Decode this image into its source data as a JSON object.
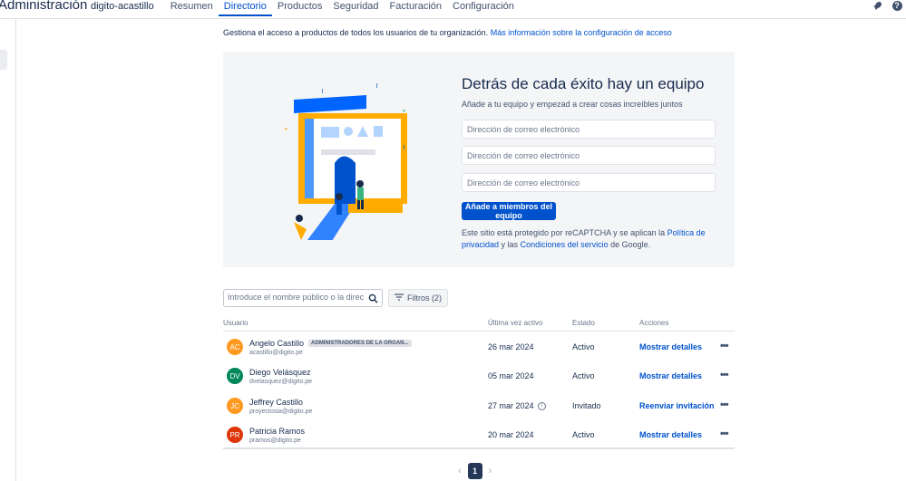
{
  "header": {
    "app_title": "Administración",
    "org_name": "digito-acastillo",
    "nav": [
      "Resumen",
      "Directorio",
      "Productos",
      "Seguridad",
      "Facturación",
      "Configuración"
    ],
    "active_nav": "Directorio"
  },
  "description": {
    "text": "Gestiona el acceso a productos de todos los usuarios de tu organización.",
    "link": "Más información sobre la configuración de acceso"
  },
  "invite": {
    "title": "Detrás de cada éxito hay un equipo",
    "subtitle": "Añade a tu equipo y empezad a crear cosas increíbles juntos",
    "email_placeholder": "Dirección de correo electrónico",
    "button": "Añade a miembros del equipo",
    "recaptcha_prefix": "Este sitio está protegido por reCAPTCHA y se aplican la",
    "privacy_link": "Política de privacidad",
    "recaptcha_middle": "y las",
    "terms_link": "Condiciones del servicio",
    "recaptcha_suffix": "de Google."
  },
  "search": {
    "placeholder": "Introduce el nombre público o la direcci"
  },
  "filters": {
    "label": "Filtros (2)"
  },
  "table": {
    "columns": [
      "Usuario",
      "Última vez activo",
      "Estado",
      "Acciones"
    ],
    "rows": [
      {
        "initials": "AC",
        "avatar_color": "#ff991f",
        "name": "Angelo Castillo",
        "badge": "ADMINISTRADORES DE LA ORGAN...",
        "email": "acastillo@digito.pe",
        "last_active": "26 mar 2024",
        "last_active_info": false,
        "status": "Activo",
        "action": "Mostrar detalles"
      },
      {
        "initials": "DV",
        "avatar_color": "#00875a",
        "name": "Diego Velásquez",
        "badge": "",
        "email": "dvelasquez@digito.pe",
        "last_active": "05 mar 2024",
        "last_active_info": false,
        "status": "Activo",
        "action": "Mostrar detalles"
      },
      {
        "initials": "JC",
        "avatar_color": "#ff991f",
        "name": "Jeffrey Castillo",
        "badge": "",
        "email": "proyectosia@digito.pe",
        "last_active": "27 mar 2024",
        "last_active_info": true,
        "status": "Invitado",
        "action": "Reenviar invitación"
      },
      {
        "initials": "PR",
        "avatar_color": "#de350b",
        "name": "Patricia Ramos",
        "badge": "",
        "email": "pramos@digito.pe",
        "last_active": "20 mar 2024",
        "last_active_info": false,
        "status": "Activo",
        "action": "Mostrar detalles"
      }
    ]
  },
  "pagination": {
    "current_page": "1"
  },
  "colors": {
    "primary": "#0052cc",
    "text": "#172b4d",
    "subtle": "#6b778c",
    "panel_bg": "#f4f5f7"
  },
  "icons": [
    "rocket-icon",
    "help-icon",
    "search-icon",
    "filter-icon",
    "more-icon",
    "info-icon",
    "chevron-left-icon",
    "chevron-right-icon"
  ]
}
